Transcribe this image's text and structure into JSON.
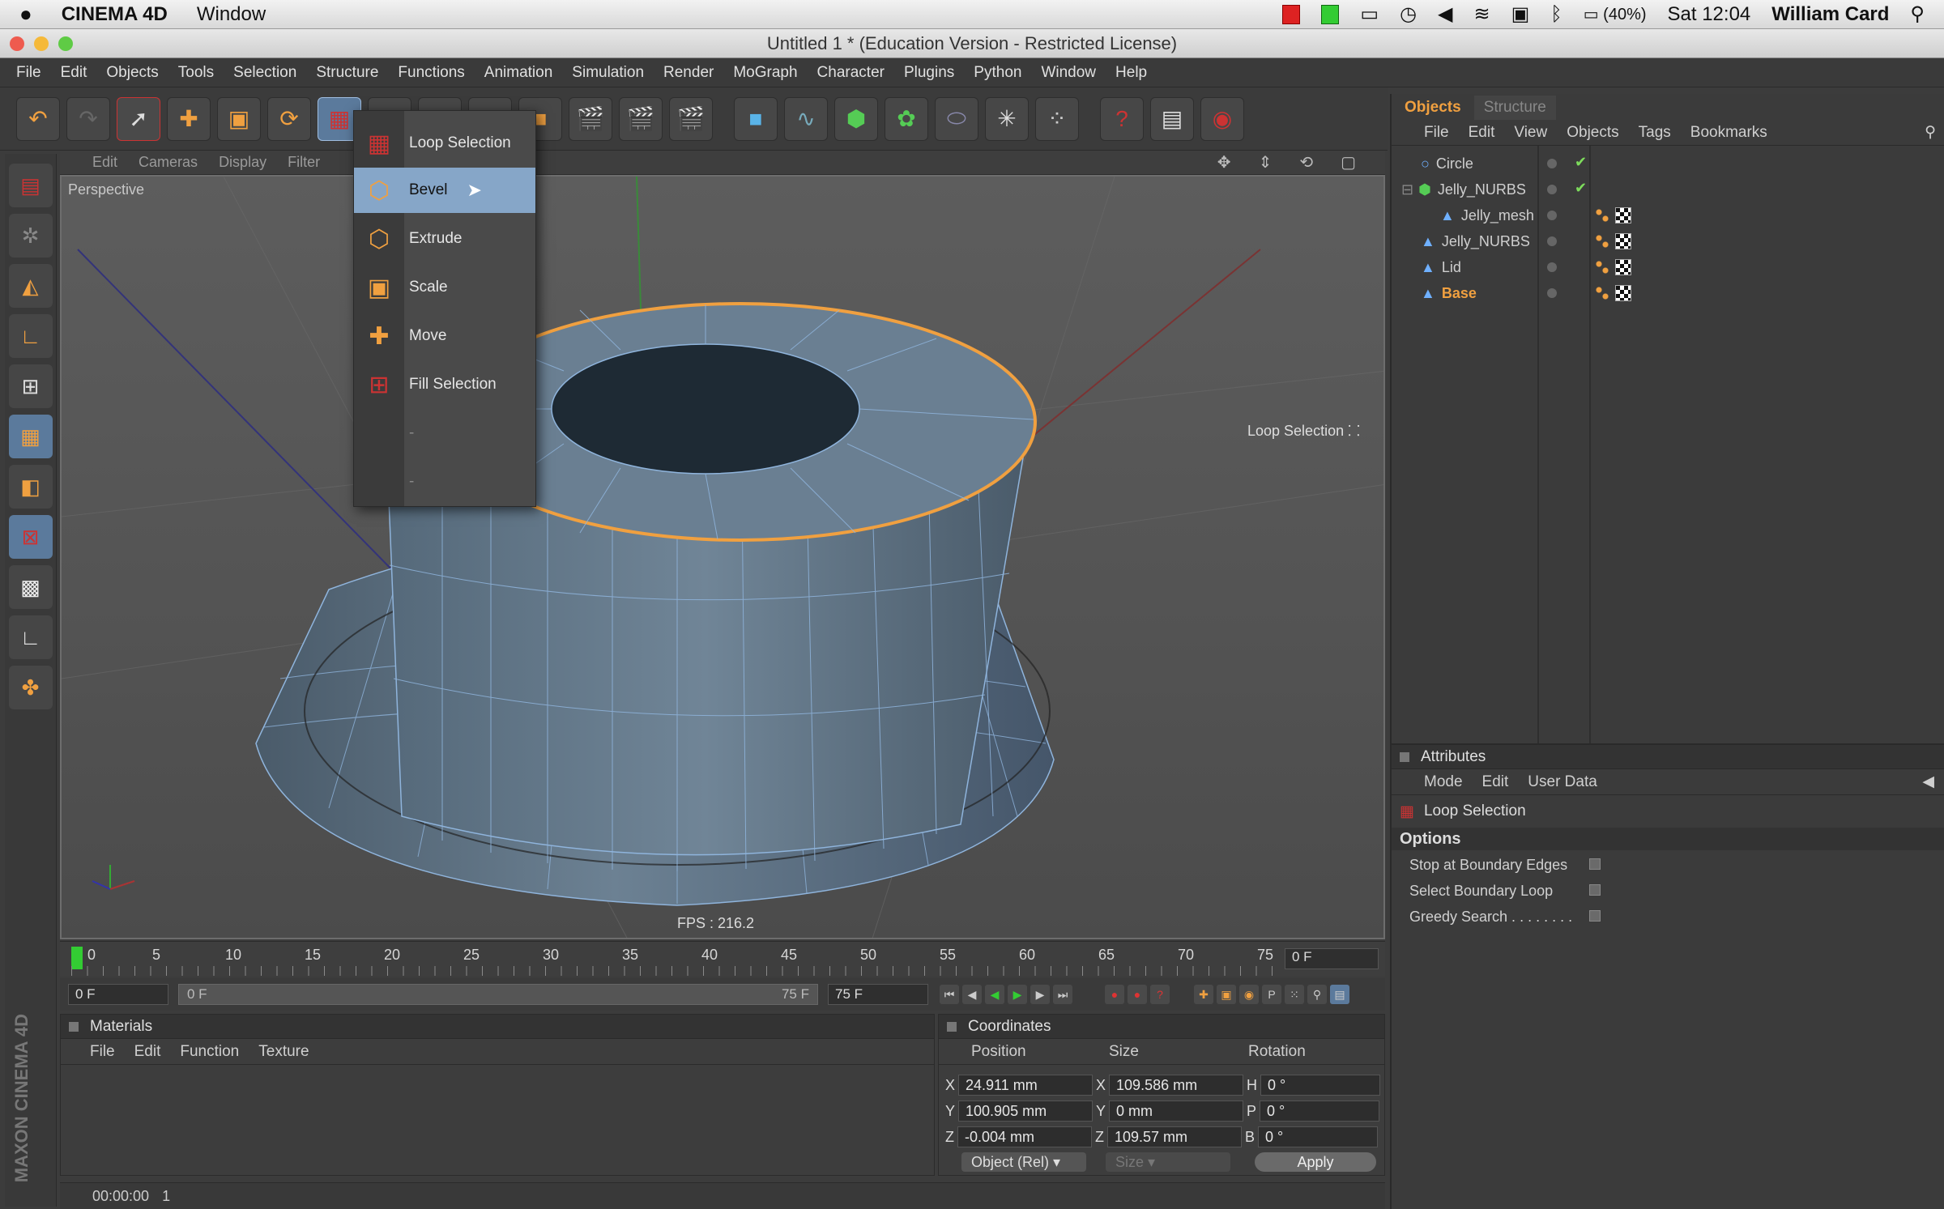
{
  "mac_menu": {
    "apple": "",
    "app": "CINEMA 4D",
    "window": "Window",
    "battery": "(40%)",
    "clock": "Sat 12:04",
    "user": "William Card"
  },
  "window_title": "Untitled 1 * (Education Version - Restricted License)",
  "menu": [
    "File",
    "Edit",
    "Objects",
    "Tools",
    "Selection",
    "Structure",
    "Functions",
    "Animation",
    "Simulation",
    "Render",
    "MoGraph",
    "Character",
    "Plugins",
    "Python",
    "Window",
    "Help"
  ],
  "viewport_menu": [
    "Edit",
    "Cameras",
    "Display",
    "Filter"
  ],
  "viewport": {
    "label": "Perspective",
    "fps": "FPS : 216.2",
    "hint": "Loop Selection"
  },
  "popup": {
    "items": [
      "Loop Selection",
      "Bevel",
      "Extrude",
      "Scale",
      "Move",
      "Fill Selection",
      "-",
      "-"
    ],
    "highlighted_index": 1
  },
  "timeline": {
    "ticks": [
      "0",
      "5",
      "10",
      "15",
      "20",
      "25",
      "30",
      "35",
      "40",
      "45",
      "50",
      "55",
      "60",
      "65",
      "70",
      "75"
    ],
    "current_frame": "0 F"
  },
  "playback": {
    "start": "0 F",
    "slider_start": "0 F",
    "slider_end": "75 F",
    "end": "75 F"
  },
  "materials": {
    "title": "Materials",
    "menu": [
      "File",
      "Edit",
      "Function",
      "Texture"
    ]
  },
  "coordinates": {
    "title": "Coordinates",
    "headers": [
      "Position",
      "Size",
      "Rotation"
    ],
    "rows": [
      {
        "axis": "X",
        "pos": "24.911 mm",
        "saxis": "X",
        "size": "109.586 mm",
        "raxis": "H",
        "rot": "0 °"
      },
      {
        "axis": "Y",
        "pos": "100.905 mm",
        "saxis": "Y",
        "size": "0 mm",
        "raxis": "P",
        "rot": "0 °"
      },
      {
        "axis": "Z",
        "pos": "-0.004 mm",
        "saxis": "Z",
        "size": "109.57 mm",
        "raxis": "B",
        "rot": "0 °"
      }
    ],
    "mode": "Object (Rel)",
    "size_mode": "Size",
    "apply": "Apply"
  },
  "statusbar": {
    "time": "00:00:00",
    "value": "1"
  },
  "side_logo": "MAXON CINEMA 4D",
  "objects_panel": {
    "tabs": [
      "Objects",
      "Structure"
    ],
    "menu": [
      "File",
      "Edit",
      "View",
      "Objects",
      "Tags",
      "Bookmarks"
    ],
    "tree": [
      {
        "name": "Circle",
        "indent": 0
      },
      {
        "name": "Jelly_NURBS",
        "indent": 0
      },
      {
        "name": "Jelly_mesh",
        "indent": 1
      },
      {
        "name": "Jelly_NURBS",
        "indent": 0
      },
      {
        "name": "Lid",
        "indent": 0
      },
      {
        "name": "Base",
        "indent": 0
      }
    ],
    "selected": "Base"
  },
  "attributes": {
    "title": "Attributes",
    "menu": [
      "Mode",
      "Edit",
      "User Data"
    ],
    "tool": "Loop Selection",
    "section": "Options",
    "options": [
      "Stop at Boundary Edges",
      "Select Boundary Loop",
      "Greedy Search . . . . . . . ."
    ]
  },
  "colors": {
    "accent_orange": "#f0a040",
    "selection_blue": "#86a6c8"
  }
}
